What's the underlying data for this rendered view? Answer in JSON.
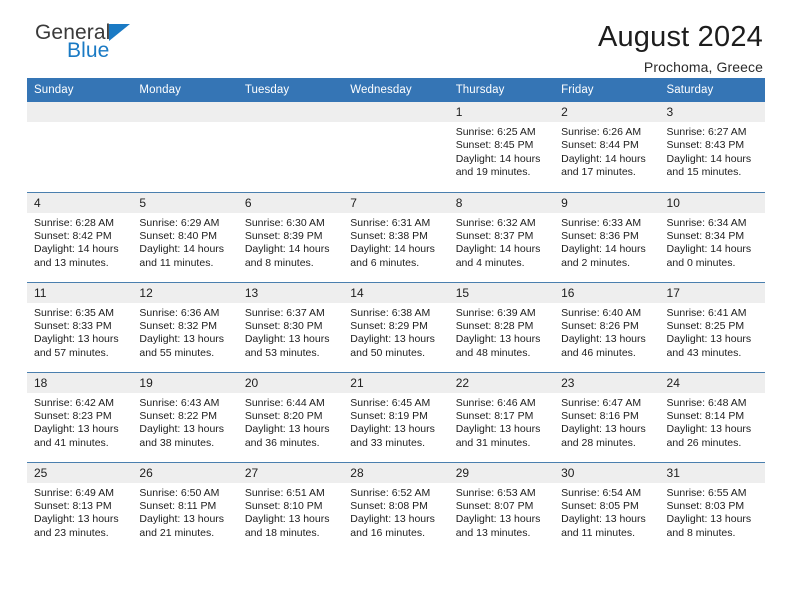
{
  "brand": {
    "name_part1": "General",
    "name_part2": "Blue",
    "logo_icon": "triangle-icon"
  },
  "header": {
    "title": "August 2024",
    "location": "Prochoma, Greece"
  },
  "colors": {
    "header_blue": "#3575b5",
    "brand_blue": "#1a7ac4",
    "daynum_band": "#eeeeee",
    "row_divider": "#4a7fae"
  },
  "calendar": {
    "weekday_headers": [
      "Sunday",
      "Monday",
      "Tuesday",
      "Wednesday",
      "Thursday",
      "Friday",
      "Saturday"
    ],
    "weeks": [
      [
        {
          "day": "",
          "sunrise": "",
          "sunset": "",
          "daylight_line1": "",
          "daylight_line2": ""
        },
        {
          "day": "",
          "sunrise": "",
          "sunset": "",
          "daylight_line1": "",
          "daylight_line2": ""
        },
        {
          "day": "",
          "sunrise": "",
          "sunset": "",
          "daylight_line1": "",
          "daylight_line2": ""
        },
        {
          "day": "",
          "sunrise": "",
          "sunset": "",
          "daylight_line1": "",
          "daylight_line2": ""
        },
        {
          "day": "1",
          "sunrise": "Sunrise: 6:25 AM",
          "sunset": "Sunset: 8:45 PM",
          "daylight_line1": "Daylight: 14 hours",
          "daylight_line2": "and 19 minutes."
        },
        {
          "day": "2",
          "sunrise": "Sunrise: 6:26 AM",
          "sunset": "Sunset: 8:44 PM",
          "daylight_line1": "Daylight: 14 hours",
          "daylight_line2": "and 17 minutes."
        },
        {
          "day": "3",
          "sunrise": "Sunrise: 6:27 AM",
          "sunset": "Sunset: 8:43 PM",
          "daylight_line1": "Daylight: 14 hours",
          "daylight_line2": "and 15 minutes."
        }
      ],
      [
        {
          "day": "4",
          "sunrise": "Sunrise: 6:28 AM",
          "sunset": "Sunset: 8:42 PM",
          "daylight_line1": "Daylight: 14 hours",
          "daylight_line2": "and 13 minutes."
        },
        {
          "day": "5",
          "sunrise": "Sunrise: 6:29 AM",
          "sunset": "Sunset: 8:40 PM",
          "daylight_line1": "Daylight: 14 hours",
          "daylight_line2": "and 11 minutes."
        },
        {
          "day": "6",
          "sunrise": "Sunrise: 6:30 AM",
          "sunset": "Sunset: 8:39 PM",
          "daylight_line1": "Daylight: 14 hours",
          "daylight_line2": "and 8 minutes."
        },
        {
          "day": "7",
          "sunrise": "Sunrise: 6:31 AM",
          "sunset": "Sunset: 8:38 PM",
          "daylight_line1": "Daylight: 14 hours",
          "daylight_line2": "and 6 minutes."
        },
        {
          "day": "8",
          "sunrise": "Sunrise: 6:32 AM",
          "sunset": "Sunset: 8:37 PM",
          "daylight_line1": "Daylight: 14 hours",
          "daylight_line2": "and 4 minutes."
        },
        {
          "day": "9",
          "sunrise": "Sunrise: 6:33 AM",
          "sunset": "Sunset: 8:36 PM",
          "daylight_line1": "Daylight: 14 hours",
          "daylight_line2": "and 2 minutes."
        },
        {
          "day": "10",
          "sunrise": "Sunrise: 6:34 AM",
          "sunset": "Sunset: 8:34 PM",
          "daylight_line1": "Daylight: 14 hours",
          "daylight_line2": "and 0 minutes."
        }
      ],
      [
        {
          "day": "11",
          "sunrise": "Sunrise: 6:35 AM",
          "sunset": "Sunset: 8:33 PM",
          "daylight_line1": "Daylight: 13 hours",
          "daylight_line2": "and 57 minutes."
        },
        {
          "day": "12",
          "sunrise": "Sunrise: 6:36 AM",
          "sunset": "Sunset: 8:32 PM",
          "daylight_line1": "Daylight: 13 hours",
          "daylight_line2": "and 55 minutes."
        },
        {
          "day": "13",
          "sunrise": "Sunrise: 6:37 AM",
          "sunset": "Sunset: 8:30 PM",
          "daylight_line1": "Daylight: 13 hours",
          "daylight_line2": "and 53 minutes."
        },
        {
          "day": "14",
          "sunrise": "Sunrise: 6:38 AM",
          "sunset": "Sunset: 8:29 PM",
          "daylight_line1": "Daylight: 13 hours",
          "daylight_line2": "and 50 minutes."
        },
        {
          "day": "15",
          "sunrise": "Sunrise: 6:39 AM",
          "sunset": "Sunset: 8:28 PM",
          "daylight_line1": "Daylight: 13 hours",
          "daylight_line2": "and 48 minutes."
        },
        {
          "day": "16",
          "sunrise": "Sunrise: 6:40 AM",
          "sunset": "Sunset: 8:26 PM",
          "daylight_line1": "Daylight: 13 hours",
          "daylight_line2": "and 46 minutes."
        },
        {
          "day": "17",
          "sunrise": "Sunrise: 6:41 AM",
          "sunset": "Sunset: 8:25 PM",
          "daylight_line1": "Daylight: 13 hours",
          "daylight_line2": "and 43 minutes."
        }
      ],
      [
        {
          "day": "18",
          "sunrise": "Sunrise: 6:42 AM",
          "sunset": "Sunset: 8:23 PM",
          "daylight_line1": "Daylight: 13 hours",
          "daylight_line2": "and 41 minutes."
        },
        {
          "day": "19",
          "sunrise": "Sunrise: 6:43 AM",
          "sunset": "Sunset: 8:22 PM",
          "daylight_line1": "Daylight: 13 hours",
          "daylight_line2": "and 38 minutes."
        },
        {
          "day": "20",
          "sunrise": "Sunrise: 6:44 AM",
          "sunset": "Sunset: 8:20 PM",
          "daylight_line1": "Daylight: 13 hours",
          "daylight_line2": "and 36 minutes."
        },
        {
          "day": "21",
          "sunrise": "Sunrise: 6:45 AM",
          "sunset": "Sunset: 8:19 PM",
          "daylight_line1": "Daylight: 13 hours",
          "daylight_line2": "and 33 minutes."
        },
        {
          "day": "22",
          "sunrise": "Sunrise: 6:46 AM",
          "sunset": "Sunset: 8:17 PM",
          "daylight_line1": "Daylight: 13 hours",
          "daylight_line2": "and 31 minutes."
        },
        {
          "day": "23",
          "sunrise": "Sunrise: 6:47 AM",
          "sunset": "Sunset: 8:16 PM",
          "daylight_line1": "Daylight: 13 hours",
          "daylight_line2": "and 28 minutes."
        },
        {
          "day": "24",
          "sunrise": "Sunrise: 6:48 AM",
          "sunset": "Sunset: 8:14 PM",
          "daylight_line1": "Daylight: 13 hours",
          "daylight_line2": "and 26 minutes."
        }
      ],
      [
        {
          "day": "25",
          "sunrise": "Sunrise: 6:49 AM",
          "sunset": "Sunset: 8:13 PM",
          "daylight_line1": "Daylight: 13 hours",
          "daylight_line2": "and 23 minutes."
        },
        {
          "day": "26",
          "sunrise": "Sunrise: 6:50 AM",
          "sunset": "Sunset: 8:11 PM",
          "daylight_line1": "Daylight: 13 hours",
          "daylight_line2": "and 21 minutes."
        },
        {
          "day": "27",
          "sunrise": "Sunrise: 6:51 AM",
          "sunset": "Sunset: 8:10 PM",
          "daylight_line1": "Daylight: 13 hours",
          "daylight_line2": "and 18 minutes."
        },
        {
          "day": "28",
          "sunrise": "Sunrise: 6:52 AM",
          "sunset": "Sunset: 8:08 PM",
          "daylight_line1": "Daylight: 13 hours",
          "daylight_line2": "and 16 minutes."
        },
        {
          "day": "29",
          "sunrise": "Sunrise: 6:53 AM",
          "sunset": "Sunset: 8:07 PM",
          "daylight_line1": "Daylight: 13 hours",
          "daylight_line2": "and 13 minutes."
        },
        {
          "day": "30",
          "sunrise": "Sunrise: 6:54 AM",
          "sunset": "Sunset: 8:05 PM",
          "daylight_line1": "Daylight: 13 hours",
          "daylight_line2": "and 11 minutes."
        },
        {
          "day": "31",
          "sunrise": "Sunrise: 6:55 AM",
          "sunset": "Sunset: 8:03 PM",
          "daylight_line1": "Daylight: 13 hours",
          "daylight_line2": "and 8 minutes."
        }
      ]
    ]
  }
}
